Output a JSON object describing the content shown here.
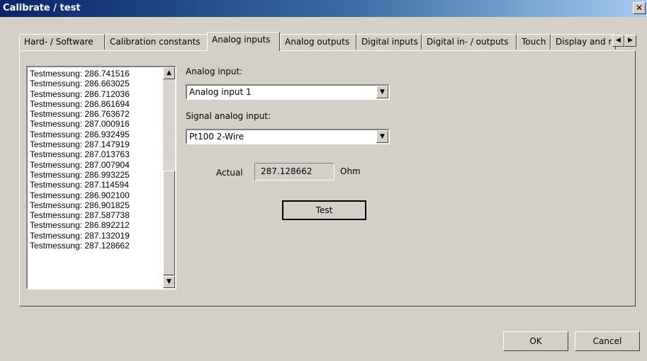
{
  "window": {
    "title": "Calibrate / test",
    "close_glyph": "✕"
  },
  "tabs": [
    {
      "label": "Hard- / Software"
    },
    {
      "label": "Calibration constants"
    },
    {
      "label": "Analog inputs",
      "active": true
    },
    {
      "label": "Analog outputs"
    },
    {
      "label": "Digital inputs"
    },
    {
      "label": "Digital in- / outputs"
    },
    {
      "label": "Touch"
    },
    {
      "label": "Display and r"
    }
  ],
  "tab_scroll": {
    "left_icon": "arrow-left-icon",
    "right_icon": "arrow-right-icon"
  },
  "log": {
    "items": [
      "Testmessung: 286.741516",
      "Testmessung: 286.663025",
      "Testmessung: 286.712036",
      "Testmessung: 286.861694",
      "Testmessung: 286.763672",
      "Testmessung: 287.000916",
      "Testmessung: 286.932495",
      "Testmessung: 287.147919",
      "Testmessung: 287.013763",
      "Testmessung: 287.007904",
      "Testmessung: 286.993225",
      "Testmessung: 287.114594",
      "Testmessung: 286.902100",
      "Testmessung: 286.901825",
      "Testmessung: 287.587738",
      "Testmessung: 286.892212",
      "Testmessung: 287.132019",
      "Testmessung: 287.128662"
    ]
  },
  "analog_input": {
    "label": "Analog input:",
    "value": "Analog input 1"
  },
  "signal_input": {
    "label": "Signal analog input:",
    "value": "Pt100 2-Wire"
  },
  "actual": {
    "label": "Actual",
    "value": "287.128662",
    "unit": "Ohm"
  },
  "buttons": {
    "test": "Test",
    "ok": "OK",
    "cancel": "Cancel"
  },
  "colors": {
    "face": "#d4d0c8",
    "title_start": "#0a246a",
    "title_end": "#a6caf0"
  }
}
